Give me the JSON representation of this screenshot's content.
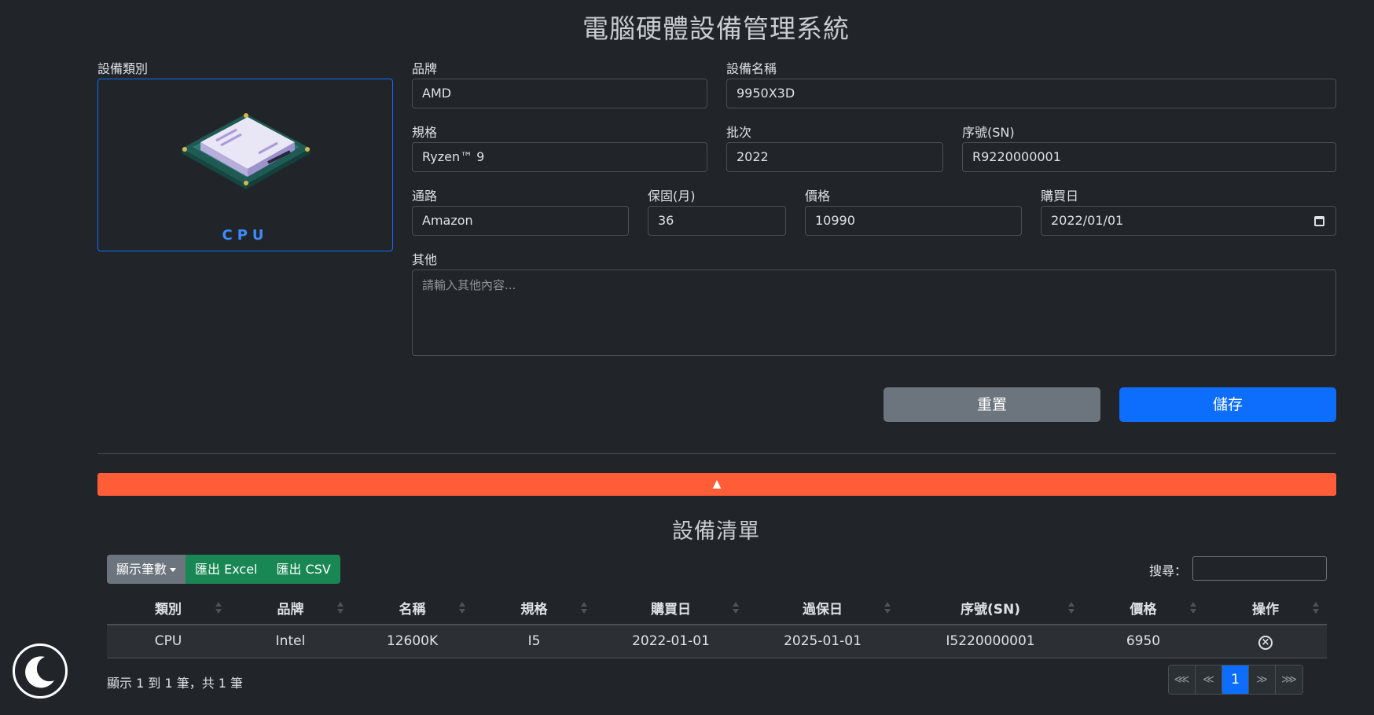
{
  "app": {
    "title": "電腦硬體設備管理系統"
  },
  "form": {
    "category_label": "設備類別",
    "category_value": "CPU",
    "brand_label": "品牌",
    "brand_value": "AMD",
    "name_label": "設備名稱",
    "name_value": "9950X3D",
    "spec_label": "規格",
    "spec_value": "Ryzen™ 9",
    "batch_label": "批次",
    "batch_value": "2022",
    "sn_label": "序號(SN)",
    "sn_value": "R9220000001",
    "channel_label": "通路",
    "channel_value": "Amazon",
    "warranty_label": "保固(月)",
    "warranty_value": "36",
    "price_label": "價格",
    "price_value": "10990",
    "purchase_label": "購買日",
    "purchase_value": "2022/01/01",
    "other_label": "其他",
    "other_placeholder": "請輸入其他內容...",
    "reset_label": "重置",
    "save_label": "儲存",
    "collapse_arrow": "▲"
  },
  "list": {
    "title": "設備清單",
    "page_size_label": "顯示筆數",
    "export_excel_label": "匯出 Excel",
    "export_csv_label": "匯出 CSV",
    "search_label": "搜尋：",
    "columns": [
      "類別",
      "品牌",
      "名稱",
      "規格",
      "購買日",
      "過保日",
      "序號(SN)",
      "價格",
      "操作"
    ],
    "rows": [
      {
        "category": "CPU",
        "brand": "Intel",
        "name": "12600K",
        "spec": "I5",
        "purchase": "2022-01-01",
        "expire": "2025-01-01",
        "sn": "I5220000001",
        "price": "6950",
        "action_icon": "delete-circle-x-icon"
      }
    ],
    "info": "顯示 1 到 1 筆，共 1 筆",
    "pager": {
      "first": "⋘",
      "prev": "≪",
      "current": "1",
      "next": "≫",
      "last": "⋙"
    }
  },
  "theme": {
    "accent": "#0d6efd",
    "danger_bar": "#ff5c38",
    "success": "#198754",
    "secondary": "#6c757d",
    "toggle_icon": "moon-icon"
  }
}
